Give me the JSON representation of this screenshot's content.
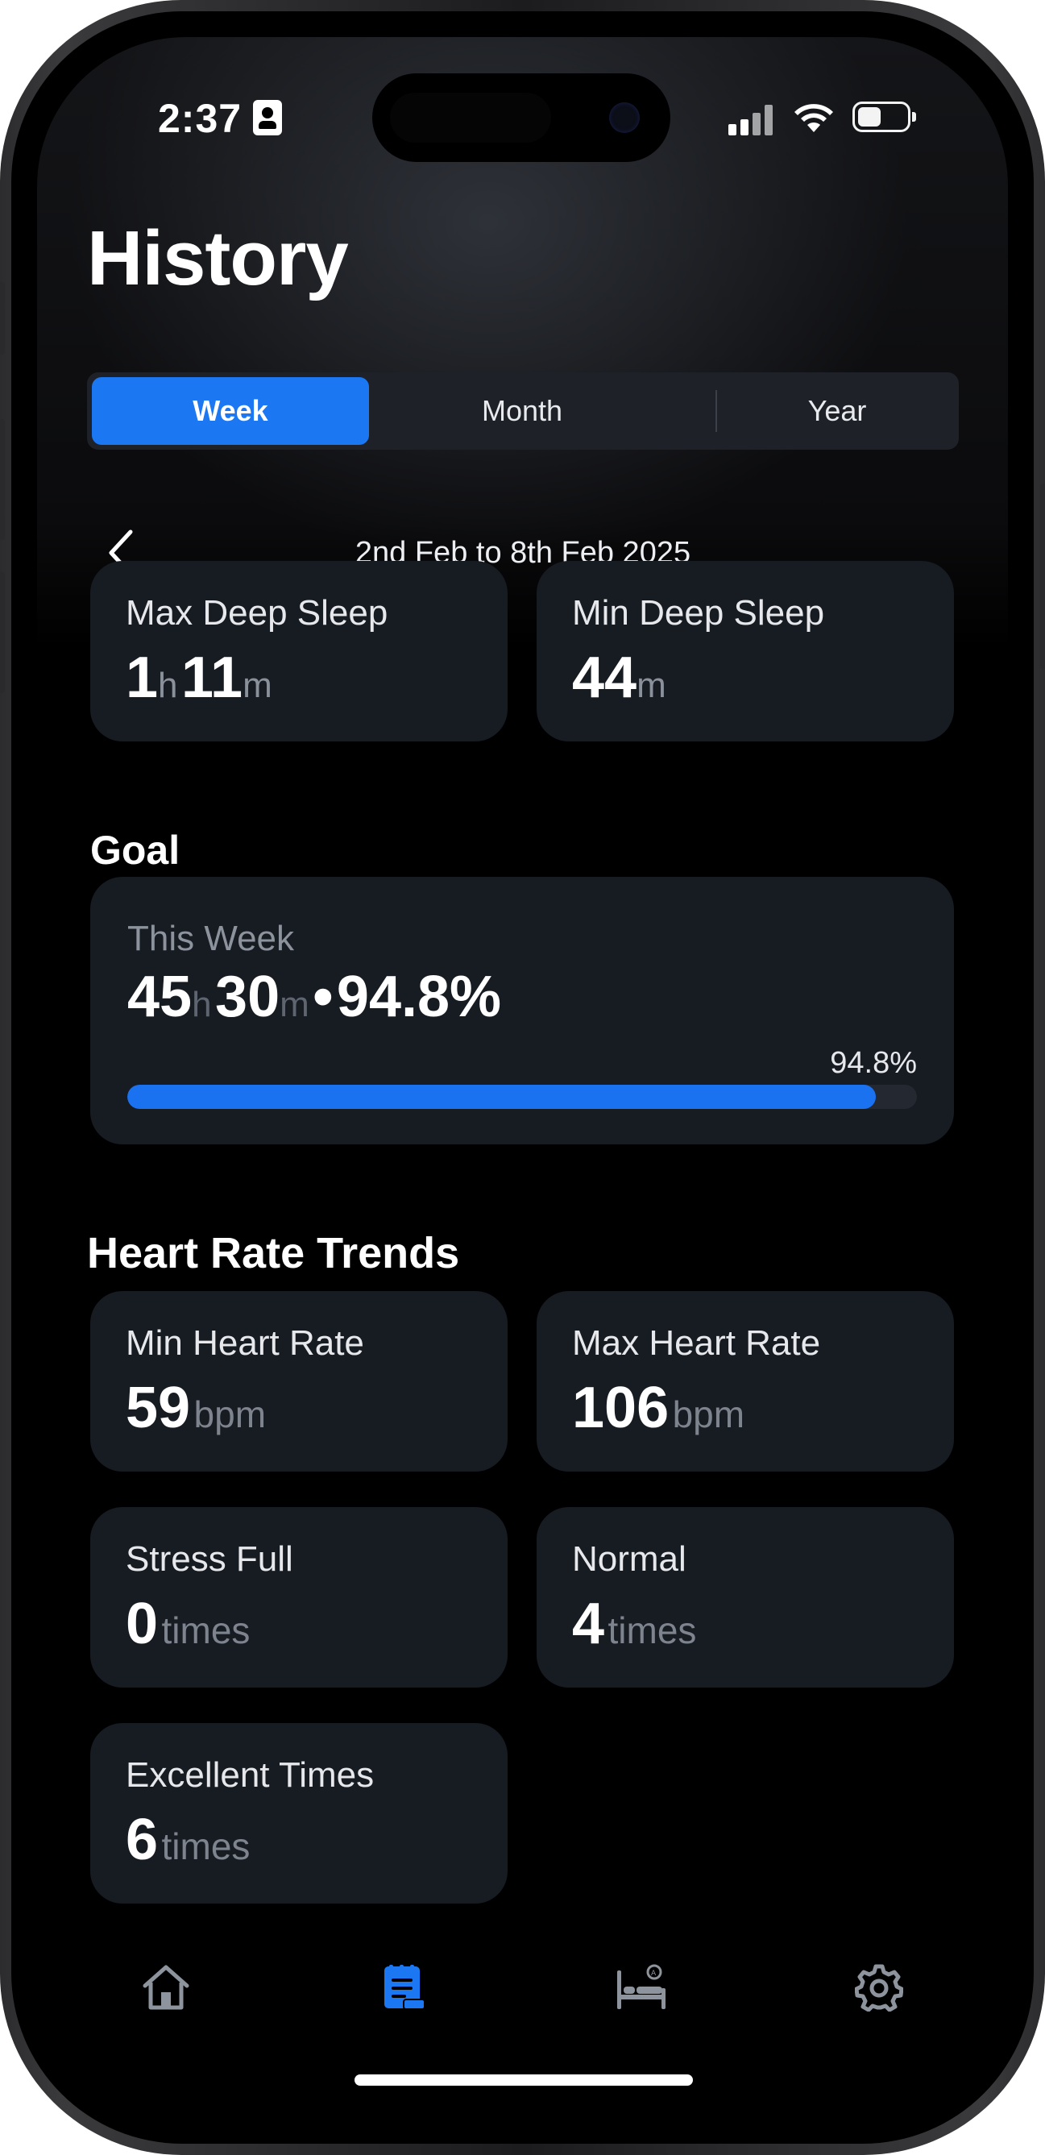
{
  "status_bar": {
    "time": "2:37"
  },
  "title": "History",
  "period_tabs": [
    {
      "label": "Week",
      "active": true
    },
    {
      "label": "Month",
      "active": false
    },
    {
      "label": "Year",
      "active": false
    }
  ],
  "date_range": "2nd Feb to 8th Feb 2025",
  "deep_sleep": {
    "max": {
      "label": "Max Deep Sleep",
      "hours": "1",
      "h_unit": "h",
      "minutes": "11",
      "m_unit": "m"
    },
    "min": {
      "label": "Min Deep Sleep",
      "minutes": "44",
      "m_unit": "m"
    }
  },
  "goal": {
    "section_title": "Goal",
    "period_label": "This Week",
    "hours": "45",
    "h_unit": "h",
    "minutes": "30",
    "m_unit": "m",
    "separator": "•",
    "percent_text": "94.8%",
    "progress_label": "94.8%",
    "progress_fraction": 0.948
  },
  "heart_rate": {
    "section_title": "Heart Rate Trends",
    "cards": [
      {
        "label": "Min Heart Rate",
        "value": "59",
        "unit": "bpm"
      },
      {
        "label": "Max Heart Rate",
        "value": "106",
        "unit": "bpm"
      },
      {
        "label": "Stress Full",
        "value": "0",
        "unit": "times"
      },
      {
        "label": "Normal",
        "value": "4",
        "unit": "times"
      },
      {
        "label": "Excellent Times",
        "value": "6",
        "unit": "times"
      }
    ]
  },
  "tab_bar": {
    "items": [
      {
        "icon": "home-icon",
        "active": false
      },
      {
        "icon": "history-icon",
        "active": true
      },
      {
        "icon": "sleep-bed-icon",
        "active": false
      },
      {
        "icon": "settings-gear-icon",
        "active": false
      }
    ]
  },
  "colors": {
    "accent": "#1b78f2",
    "card_bg": "#171b22",
    "background": "#000000",
    "inactive_icon": "#8e949d"
  }
}
